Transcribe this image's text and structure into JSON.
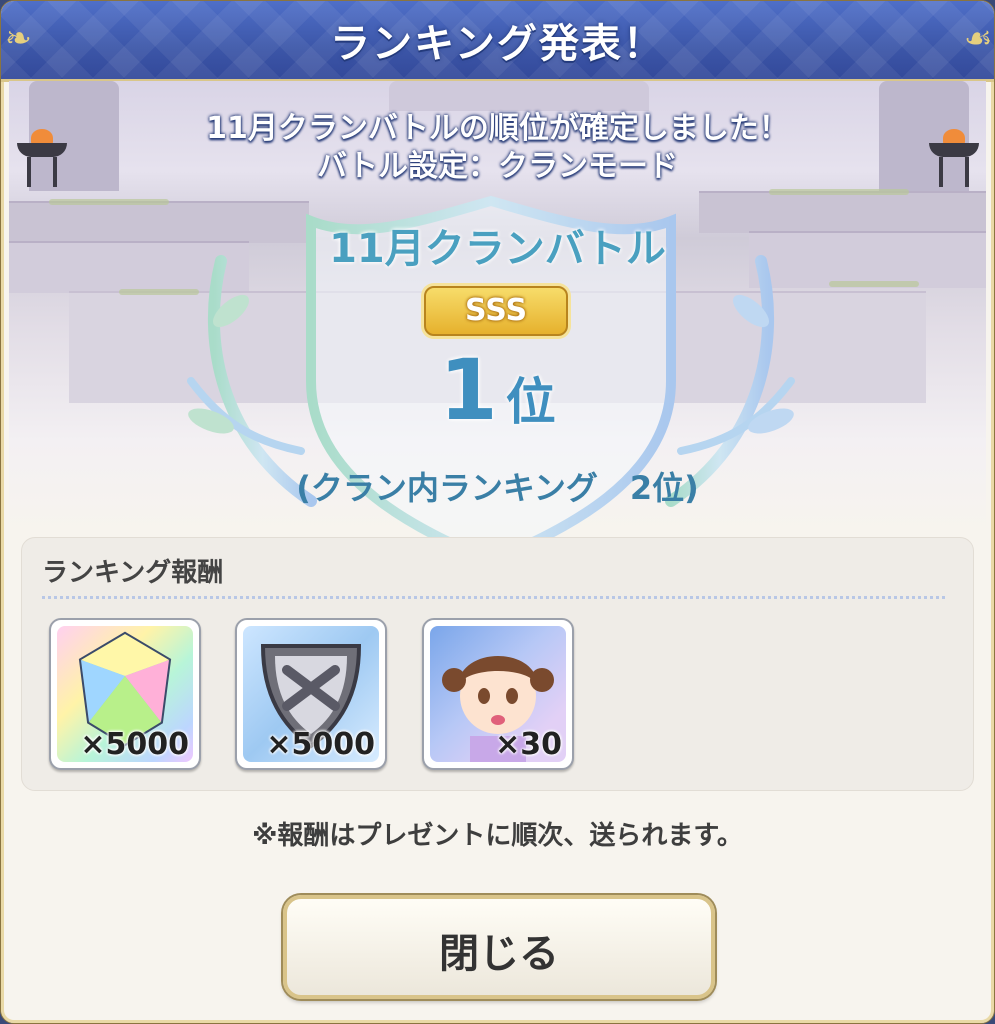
{
  "header": {
    "title": "ランキング発表！"
  },
  "intro": {
    "line1": "11月クランバトルの順位が確定しました！",
    "line2": "バトル設定：クランモード"
  },
  "result": {
    "battle_name": "11月クランバトル",
    "rank_badge": "SSS",
    "place_number": "1",
    "place_suffix": "位",
    "clan_internal_ranking": "(クラン内ランキング　2位)"
  },
  "rewards": {
    "heading": "ランキング報酬",
    "items": [
      {
        "icon": "jewel-icon",
        "quantity": "×5000"
      },
      {
        "icon": "clan-coin-icon",
        "quantity": "×5000"
      },
      {
        "icon": "character-memory-piece-icon",
        "quantity": "×30"
      }
    ]
  },
  "note": "※報酬はプレゼントに順次、送られます。",
  "close_button": {
    "label": "閉じる"
  },
  "colors": {
    "header_blue": "#3c56a8",
    "gold": "#e6b12d",
    "rank_text": "#3f8fbf"
  }
}
